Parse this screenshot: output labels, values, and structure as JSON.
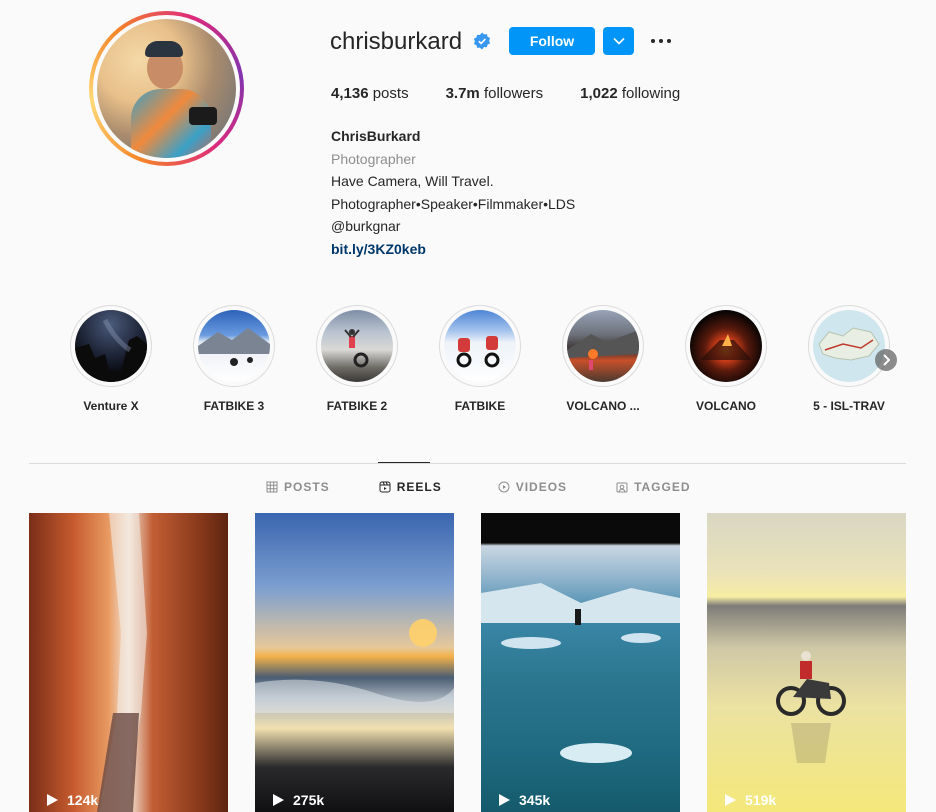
{
  "profile": {
    "username": "chrisburkard",
    "verified": true,
    "follow_label": "Follow",
    "stats": {
      "posts_count": "4,136",
      "posts_label": "posts",
      "followers_count": "3.7m",
      "followers_label": "followers",
      "following_count": "1,022",
      "following_label": "following"
    },
    "bio": {
      "name": "ChrisBurkard",
      "category": "Photographer",
      "line1": "Have Camera, Will Travel.",
      "line2": "Photographer•Speaker•Filmmaker•LDS",
      "line3": "@burkgnar",
      "link": "bit.ly/3KZ0keb"
    }
  },
  "highlights": [
    {
      "label": "Venture X"
    },
    {
      "label": "FATBIKE 3"
    },
    {
      "label": "FATBIKE 2"
    },
    {
      "label": "FATBIKE"
    },
    {
      "label": "VOLCANO ..."
    },
    {
      "label": "VOLCANO"
    },
    {
      "label": "5 - ISL-TRAV"
    }
  ],
  "tabs": [
    {
      "label": "POSTS",
      "icon": "grid-icon",
      "active": false
    },
    {
      "label": "REELS",
      "icon": "reels-icon",
      "active": true
    },
    {
      "label": "VIDEOS",
      "icon": "play-circle-icon",
      "active": false
    },
    {
      "label": "TAGGED",
      "icon": "tag-icon",
      "active": false
    }
  ],
  "reels": [
    {
      "views": "124k"
    },
    {
      "views": "275k"
    },
    {
      "views": "345k"
    },
    {
      "views": "519k"
    }
  ],
  "colors": {
    "accent": "#0095f6",
    "link": "#00376b",
    "muted": "#8e8e8e",
    "text": "#262626",
    "background": "#fafafa"
  }
}
